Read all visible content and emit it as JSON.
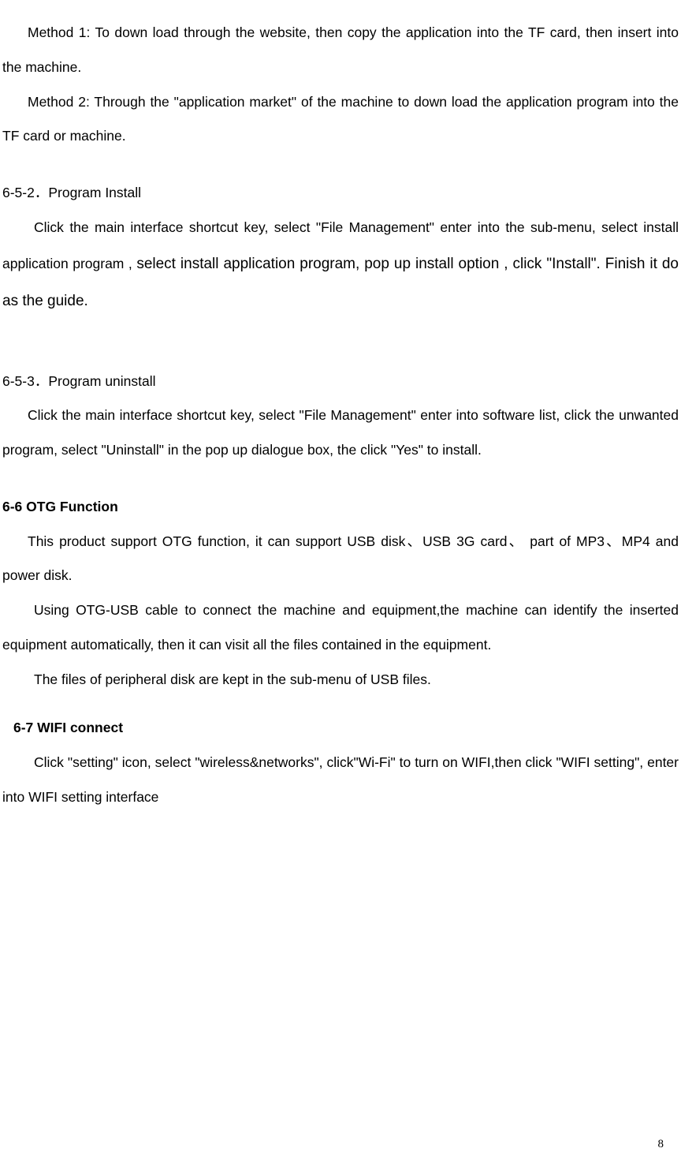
{
  "paragraphs": {
    "method1": "Method 1: To down load through the website, then copy the application into the TF card, then insert into the machine.",
    "method2": "Method 2: Through the \"application market\" of the machine to down load the application program into the TF card or machine.",
    "heading_652": "6-5-2．Program Install",
    "para_652_a": "Click the main interface shortcut key, select \"File Management\" enter into the sub-menu, select install application program , ",
    "para_652_b": "select install application program, pop up install option , click \"Install\". Finish it do as the guide.",
    "heading_653": "6-5-3．Program uninstall",
    "para_653": "Click the main interface shortcut key, select \"File Management\" enter into software list, click the unwanted program, select \"Uninstall\" in the pop up dialogue box, the click \"Yes\" to install.",
    "heading_66": "6-6  OTG Function",
    "para_66a": "This product support OTG function, it can support USB disk、USB 3G card、  part of MP3、MP4 and power disk.",
    "para_66b": "Using OTG-USB cable to connect the machine and equipment,the machine can identify the inserted equipment automatically, then it can visit all the files contained in the equipment.",
    "para_66c": "The files of peripheral disk are kept in the sub-menu of USB files.",
    "heading_67": "6-7 WIFI connect",
    "para_67": "Click \"setting\" icon, select \"wireless&networks\", click\"Wi-Fi\" to turn on WIFI,then click \"WIFI setting\", enter into WIFI setting interface"
  },
  "page_number": "8"
}
